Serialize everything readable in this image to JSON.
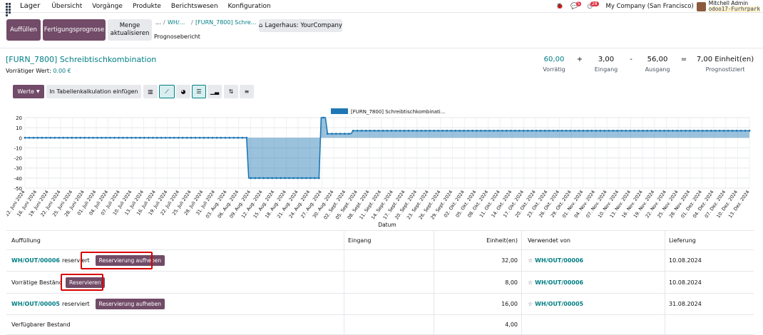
{
  "app": {
    "name": "Lager",
    "menu": [
      "Übersicht",
      "Vorgänge",
      "Produkte",
      "Berichtswesen",
      "Konfiguration"
    ]
  },
  "systray": {
    "msg_badge": "5",
    "activity_badge": "28",
    "company": "My Company (San Francisco)",
    "user": "Mitchell Admin",
    "db": "odoo17-Furhrpark"
  },
  "control": {
    "btn_replenish": "Auffüllen",
    "btn_mo": "Fertigungsprognose",
    "btn_update_line1": "Menge",
    "btn_update_line2": "aktualisieren",
    "crumb_sep": "...",
    "crumb1": "WH/...",
    "crumb2": "[FURN_7800] Schre...",
    "crumb_current": "Prognosebericht",
    "warehouse": "Lagerhaus: YourCompany"
  },
  "header": {
    "title": "[FURN_7800] Schreibtischkombination",
    "sub_label": "Vorrätiger Wert:",
    "sub_value": "0.00 €",
    "stats": [
      {
        "value": "60,00",
        "label": "Vorrätig"
      },
      {
        "op": "+"
      },
      {
        "value": "3,00",
        "label": "Eingang"
      },
      {
        "op": "-"
      },
      {
        "value": "56,00",
        "label": "Ausgang"
      },
      {
        "op": "="
      },
      {
        "value": "7,00 Einheit(en)",
        "label": "Prognostiziert"
      }
    ]
  },
  "toolbar": {
    "values_btn": "Werte",
    "spreadsheet_btn": "In Tabellenkalkulation einfügen"
  },
  "chart_data": {
    "type": "line",
    "legend": "[FURN_7800] Schreibtischkombinati...",
    "xlabel": "Datum",
    "ylim": [
      -50,
      20
    ],
    "yticks": [
      20,
      10,
      0,
      -10,
      -20,
      -30,
      -40,
      -50
    ],
    "categories": [
      "12. Juni 2024",
      "16. Juni 2024",
      "19. Juni 2024",
      "22. Juni 2024",
      "25. Juni 2024",
      "28. Juni 2024",
      "01. Juli 2024",
      "04. Juli 2024",
      "07. Juli 2024",
      "10. Juli 2024",
      "13. Juli 2024",
      "16. Juli 2024",
      "19. Juli 2024",
      "22. Juli 2024",
      "25. Juli 2024",
      "28. Juli 2024",
      "31. Juli 2024",
      "03. Aug. 2024",
      "06. Aug. 2024",
      "09. Aug. 2024",
      "12. Aug. 2024",
      "15. Aug. 2024",
      "18. Aug. 2024",
      "21. Aug. 2024",
      "24. Aug. 2024",
      "27. Aug. 2024",
      "30. Aug. 2024",
      "02. Sept. 2024",
      "05. Sept. 2024",
      "08. Sept. 2024",
      "11. Sept. 2024",
      "14. Sept. 2024",
      "17. Sept. 2024",
      "20. Sept. 2024",
      "23. Sept. 2024",
      "26. Sept. 2024",
      "29. Sept. 2024",
      "02. Okt. 2024",
      "05. Okt. 2024",
      "08. Okt. 2024",
      "11. Okt. 2024",
      "14. Okt. 2024",
      "17. Okt. 2024",
      "20. Okt. 2024",
      "23. Okt. 2024",
      "26. Okt. 2024",
      "29. Okt. 2024",
      "01. Nov. 2024",
      "04. Nov. 2024",
      "07. Nov. 2024",
      "10. Nov. 2024",
      "13. Nov. 2024",
      "16. Nov. 2024",
      "19. Nov. 2024",
      "22. Nov. 2024",
      "25. Nov. 2024",
      "28. Nov. 2024",
      "01. Dez. 2024",
      "04. Dez. 2024",
      "07. Dez. 2024",
      "10. Dez. 2024",
      "13. Dez. 2024"
    ],
    "series": [
      {
        "name": "[FURN_7800] Schreibtischkombinati...",
        "segments": [
          {
            "from": 0,
            "to": 104,
            "value": 0
          },
          {
            "from": 105,
            "to": 138,
            "value": -40
          },
          {
            "from": 139,
            "to": 141,
            "value": 20
          },
          {
            "from": 142,
            "to": 153,
            "value": 4
          },
          {
            "from": 154,
            "to": 340,
            "value": 7
          }
        ],
        "points": 341
      }
    ],
    "color": "#1f77b4"
  },
  "table": {
    "headers": {
      "col1": "Auffüllung",
      "col2": "Eingang",
      "col3": "Einheit(en)",
      "col4": "Verwendet von",
      "col5": "Lieferung"
    },
    "rows": [
      {
        "ref": "WH/OUT/00006",
        "text": "reserviert",
        "btn": "Reservierung aufheben",
        "qty": "32,00",
        "used_by": "WH/OUT/00006",
        "date": "10.08.2024"
      },
      {
        "ref": "",
        "text": "Vorrätige Bestände",
        "btn": "Reservieren",
        "qty": "8,00",
        "used_by": "WH/OUT/00006",
        "date": "10.08.2024"
      },
      {
        "ref": "WH/OUT/00005",
        "text": "reserviert",
        "btn": "Reservierung aufheben",
        "qty": "16,00",
        "used_by": "WH/OUT/00005",
        "date": "31.08.2024"
      },
      {
        "ref": "",
        "text": "Verfügbarer Bestand",
        "btn": "",
        "qty": "4,00",
        "used_by": "",
        "date": ""
      }
    ]
  }
}
